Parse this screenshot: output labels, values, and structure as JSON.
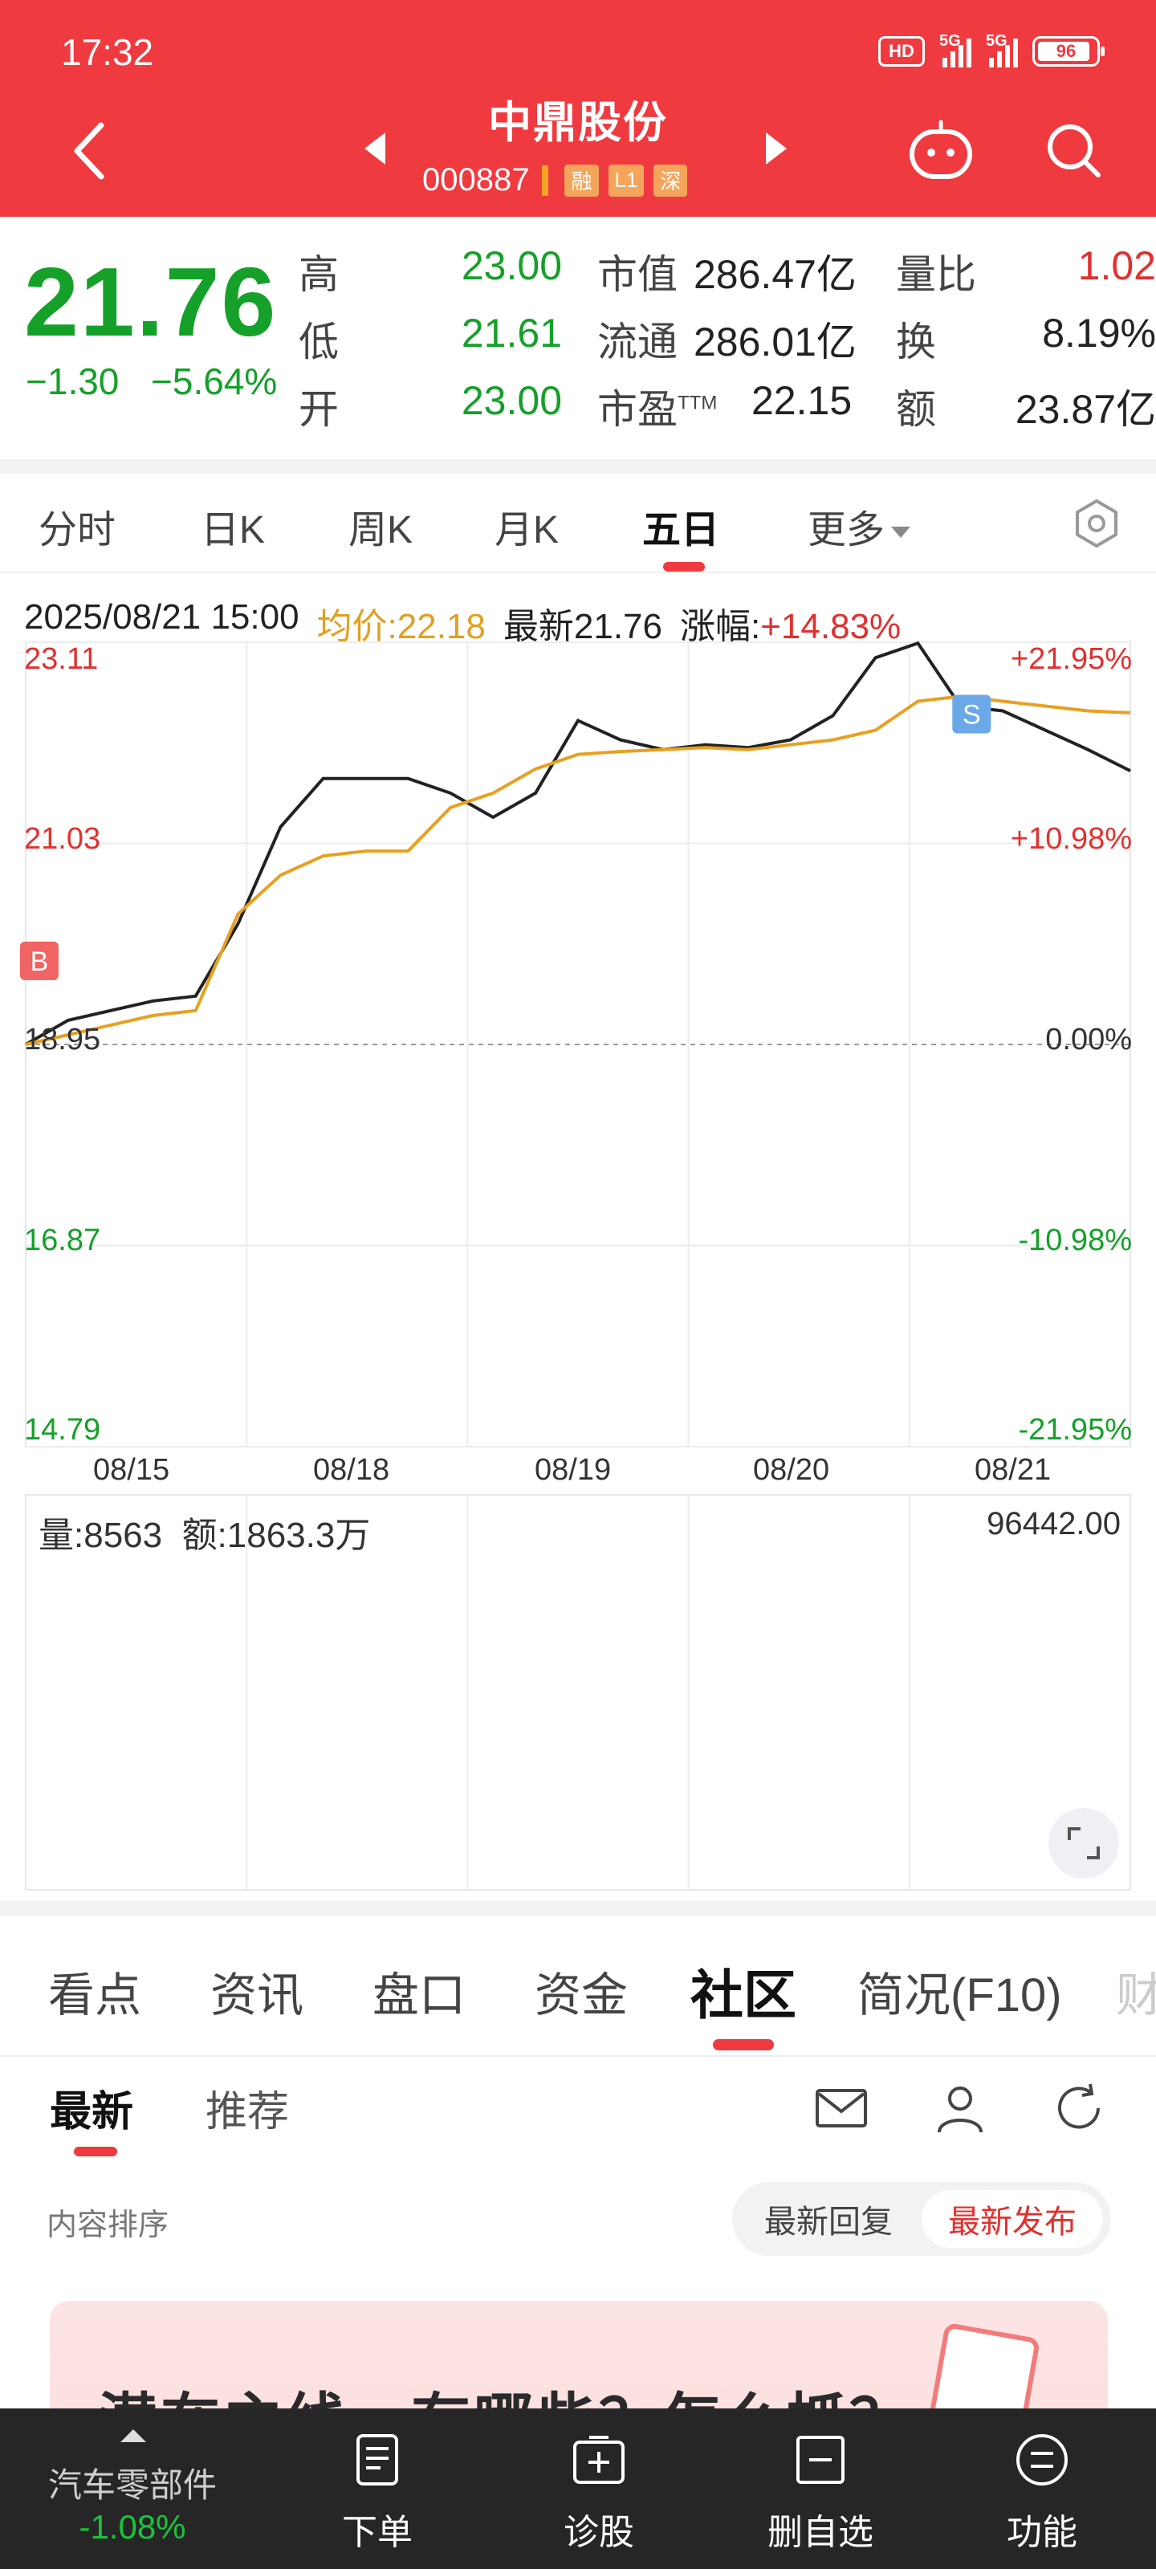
{
  "status_bar": {
    "time": "17:32",
    "hd": "HD",
    "net1": "5G",
    "net2": "5G",
    "battery": "96"
  },
  "header": {
    "stock_name": "中鼎股份",
    "stock_code": "000887",
    "tags": [
      "融",
      "L1",
      "深"
    ]
  },
  "quote": {
    "price": "21.76",
    "change": "−1.30",
    "change_pct": "−5.64%",
    "high_label": "高",
    "high": "23.00",
    "low_label": "低",
    "low": "21.61",
    "open_label": "开",
    "open": "23.00",
    "mcap_label": "市值",
    "mcap": "286.47亿",
    "float_label": "流通",
    "float": "286.01亿",
    "pe_label": "市盈",
    "pe_sup": "TTM",
    "pe": "22.15",
    "vr_label": "量比",
    "vr": "1.02",
    "turnover_label": "换",
    "turnover": "8.19%",
    "amount_label": "额",
    "amount": "23.87亿"
  },
  "period_tabs": [
    "分时",
    "日K",
    "周K",
    "月K",
    "五日",
    "更多"
  ],
  "chart_info": {
    "datetime": "2025/08/21 15:00",
    "avg": "均价:22.18",
    "latest": "最新21.76",
    "change": "涨幅:",
    "change_val": "+14.83%"
  },
  "chart_data": {
    "type": "line",
    "title": "",
    "x": [
      "08/15",
      "08/18",
      "08/19",
      "08/20",
      "08/21"
    ],
    "y_ticks_left": [
      "23.11",
      "21.03",
      "18.95",
      "16.87",
      "14.79"
    ],
    "y_ticks_right": [
      "+21.95%",
      "+10.98%",
      "0.00%",
      "-10.98%",
      "-21.95%"
    ],
    "ylim": [
      14.79,
      23.11
    ],
    "series": [
      {
        "name": "",
        "color": "#222222",
        "values": [
          18.95,
          19.2,
          19.3,
          19.4,
          19.45,
          20.2,
          21.2,
          21.7,
          21.7,
          21.7,
          21.55,
          21.3,
          21.55,
          22.3,
          22.1,
          22.0,
          22.05,
          22.02,
          22.1,
          22.35,
          22.95,
          23.1,
          22.45,
          22.4,
          22.2,
          22.0,
          21.78
        ]
      },
      {
        "name": "",
        "color": "#e8a020",
        "values": [
          18.95,
          19.05,
          19.15,
          19.25,
          19.3,
          20.3,
          20.7,
          20.9,
          20.95,
          20.95,
          21.4,
          21.55,
          21.8,
          21.95,
          21.98,
          22.0,
          22.02,
          22.0,
          22.05,
          22.1,
          22.2,
          22.5,
          22.55,
          22.5,
          22.45,
          22.4,
          22.38
        ]
      }
    ],
    "markers": [
      {
        "label": "B"
      },
      {
        "label": "S"
      }
    ],
    "volume": {
      "label": "量:8563",
      "amount": "额:1863.3万",
      "max": "96442.00"
    }
  },
  "info_tabs": [
    "看点",
    "资讯",
    "盘口",
    "资金",
    "社区",
    "简况(F10)",
    "财"
  ],
  "sub_tabs": [
    "最新",
    "推荐"
  ],
  "sort": {
    "label": "内容排序",
    "option_a": "最新回复",
    "option_b": "最新发布"
  },
  "banner": {
    "title": "潜在主线，有哪些？怎么抓？"
  },
  "bottom_nav": {
    "sector": "汽车零部件",
    "sector_change": "-1.08%",
    "items": [
      "下单",
      "诊股",
      "删自选",
      "功能"
    ]
  }
}
